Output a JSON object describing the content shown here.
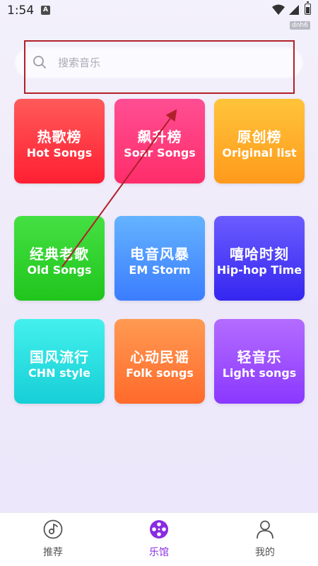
{
  "status_bar": {
    "time": "1:54",
    "notif_badge": "A",
    "dev_badge": "dnh6"
  },
  "search": {
    "placeholder": "搜索音乐",
    "value": ""
  },
  "tiles": [
    {
      "zh": "热歌榜",
      "en": "Hot Songs",
      "color_top": "#ff5a5a",
      "color_bottom": "#ff1f33"
    },
    {
      "zh": "飙升榜",
      "en": "Soar Songs",
      "color_top": "#ff4e93",
      "color_bottom": "#ff2d6a"
    },
    {
      "zh": "原创榜",
      "en": "Original list",
      "color_top": "#ffc43a",
      "color_bottom": "#ff9a1c"
    },
    {
      "zh": "经典老歌",
      "en": "Old Songs",
      "color_top": "#45e043",
      "color_bottom": "#20c51c"
    },
    {
      "zh": "电音风暴",
      "en": "EM Storm",
      "color_top": "#64b3ff",
      "color_bottom": "#3b7dff"
    },
    {
      "zh": "嘻哈时刻",
      "en": "Hip-hop Time",
      "color_top": "#6b5cff",
      "color_bottom": "#3526f0"
    },
    {
      "zh": "国风流行",
      "en": "CHN style",
      "color_top": "#44f0ed",
      "color_bottom": "#16cfd6"
    },
    {
      "zh": "心动民谣",
      "en": "Folk songs",
      "color_top": "#ff9a52",
      "color_bottom": "#ff6a2b"
    },
    {
      "zh": "轻音乐",
      "en": "Light songs",
      "color_top": "#b46cff",
      "color_bottom": "#8a38ff"
    }
  ],
  "bottom_nav": [
    {
      "label": "推荐",
      "icon": "music-disc-icon",
      "active": false
    },
    {
      "label": "乐馆",
      "icon": "film-reel-icon",
      "active": true
    },
    {
      "label": "我的",
      "icon": "person-icon",
      "active": false
    }
  ],
  "colors": {
    "accent": "#8a2be2",
    "nav_inactive": "#555555",
    "annotation": "#b0202a"
  }
}
